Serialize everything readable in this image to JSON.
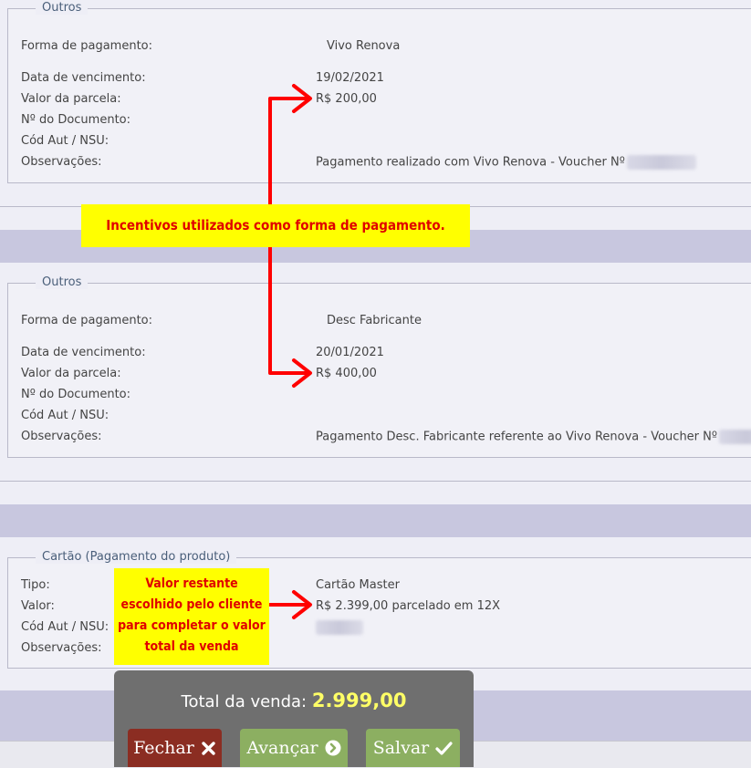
{
  "section1": {
    "legend": "Outros",
    "rows": [
      {
        "label": "Forma de pagamento:",
        "value": "Vivo Renova"
      },
      {
        "label": "Data de vencimento:",
        "value": "19/02/2021"
      },
      {
        "label": "Valor da parcela:",
        "value": "R$ 200,00"
      },
      {
        "label": "Nº do Documento:",
        "value": ""
      },
      {
        "label": "Cód Aut / NSU:",
        "value": ""
      },
      {
        "label": "Observações:",
        "value": "Pagamento realizado com Vivo Renova - Voucher Nº"
      }
    ]
  },
  "section2": {
    "legend": "Outros",
    "rows": [
      {
        "label": "Forma de pagamento:",
        "value": "Desc Fabricante"
      },
      {
        "label": "Data de vencimento:",
        "value": "20/01/2021"
      },
      {
        "label": "Valor da parcela:",
        "value": "R$ 400,00"
      },
      {
        "label": "Nº do Documento:",
        "value": ""
      },
      {
        "label": "Cód Aut / NSU:",
        "value": ""
      },
      {
        "label": "Observações:",
        "value": "Pagamento Desc. Fabricante referente ao Vivo Renova - Voucher Nº"
      }
    ]
  },
  "section3": {
    "legend": "Cartão  (Pagamento do produto)",
    "rows": [
      {
        "label": "Tipo:",
        "value": "Cartão Master"
      },
      {
        "label": "Valor:",
        "value": "R$ 2.399,00 parcelado em 12X"
      },
      {
        "label": "Cód Aut / NSU:",
        "value": ""
      },
      {
        "label": "Observações:",
        "value": ""
      }
    ]
  },
  "annotations": {
    "note1": "Incentivos utilizados como forma de pagamento.",
    "note2_lines": [
      "Valor restante",
      "escolhido pelo cliente",
      "para completar o valor",
      "total da venda"
    ]
  },
  "footer": {
    "total_label": "Total da venda:",
    "total_value": "2.999,00",
    "buttons": {
      "fechar": "Fechar",
      "avancar": "Avançar",
      "salvar": "Salvar"
    },
    "icons": {
      "fechar": "close-icon",
      "avancar": "chevron-right-circle-icon",
      "salvar": "check-icon"
    }
  },
  "colors": {
    "arrow": "#ff0000",
    "note_bg": "#ffff00",
    "note_text": "#e00000",
    "band": "#c8c7df",
    "fechar_bg": "#8b2d22",
    "green_bg": "#8caf61",
    "total_value": "#ffff66"
  }
}
